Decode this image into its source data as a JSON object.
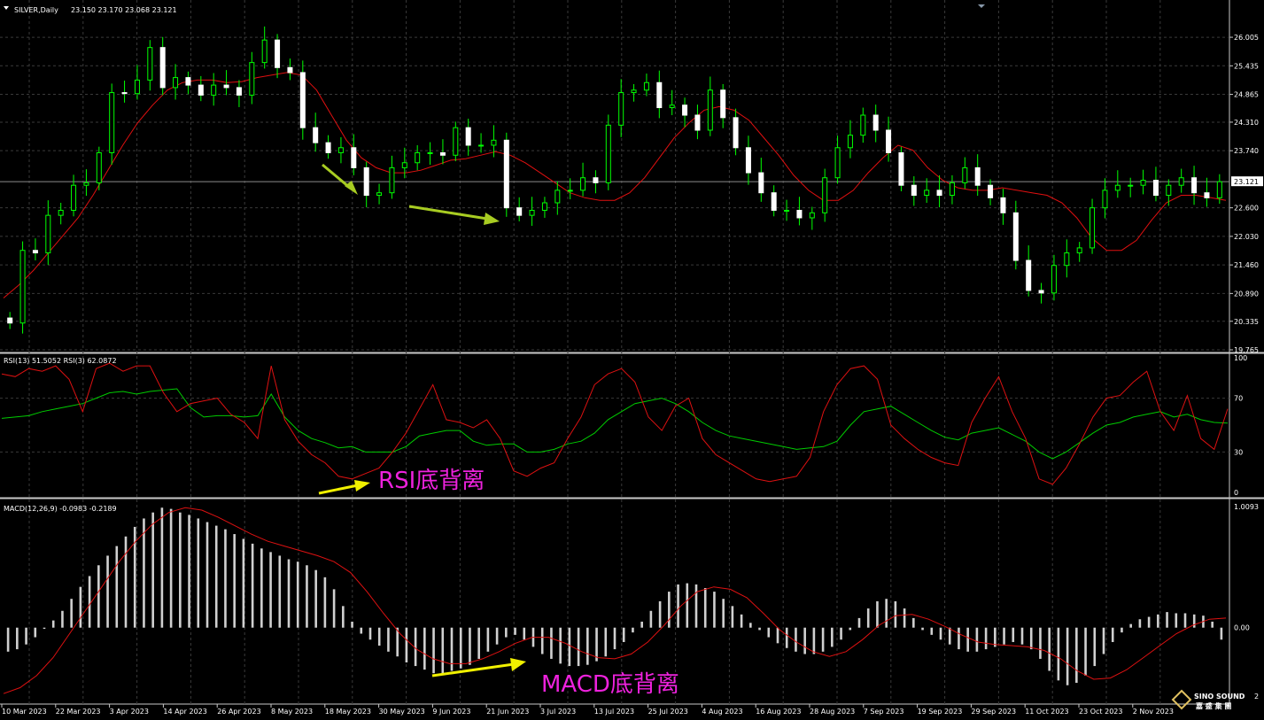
{
  "chart_data": [
    {
      "type": "candlestick",
      "title": "SILVER,Daily",
      "ohlc_header": "23.150 23.170 23.068 23.121",
      "ylim": [
        19.765,
        26.13
      ],
      "y_ticks": [
        "26.005",
        "25.435",
        "24.865",
        "24.310",
        "23.740",
        "23.121",
        "22.600",
        "22.030",
        "21.460",
        "20.890",
        "20.335",
        "19.765"
      ],
      "current_price": "23.121",
      "grid": true,
      "series": [
        {
          "name": "close",
          "color": "#00ff00",
          "values": [
            20.3,
            21.75,
            21.7,
            22.45,
            22.55,
            23.05,
            23.1,
            23.7,
            24.9,
            24.88,
            25.15,
            25.8,
            25.0,
            25.2,
            25.05,
            24.85,
            25.05,
            25.0,
            24.85,
            25.5,
            25.95,
            25.4,
            25.3,
            24.2,
            23.9,
            23.7,
            23.8,
            23.4,
            22.85,
            22.9,
            23.4,
            23.5,
            23.7,
            23.7,
            23.65,
            24.2,
            23.85,
            23.85,
            23.95,
            22.6,
            22.45,
            22.55,
            22.7,
            22.95,
            22.95,
            23.2,
            23.1,
            24.25,
            24.9,
            24.95,
            25.1,
            24.6,
            24.65,
            24.45,
            24.15,
            24.95,
            24.4,
            23.8,
            23.3,
            22.9,
            22.55,
            22.55,
            22.4,
            22.5,
            23.2,
            23.8,
            24.05,
            24.45,
            24.15,
            23.7,
            23.05,
            22.85,
            22.95,
            22.85,
            23.1,
            23.4,
            23.05,
            22.8,
            22.5,
            21.55,
            20.95,
            20.9,
            21.45,
            21.7,
            21.8,
            22.6,
            22.95,
            23.05,
            23.05,
            23.15,
            22.85,
            23.05,
            23.2,
            22.9,
            22.8,
            23.121
          ]
        },
        {
          "name": "ma",
          "color": "#e01010",
          "values": [
            20.8,
            21.05,
            21.35,
            21.7,
            22.05,
            22.4,
            22.85,
            23.35,
            23.85,
            24.3,
            24.65,
            24.95,
            25.1,
            25.15,
            25.15,
            25.1,
            25.12,
            25.2,
            25.25,
            25.3,
            25.25,
            24.95,
            24.45,
            23.95,
            23.6,
            23.4,
            23.3,
            23.3,
            23.35,
            23.45,
            23.55,
            23.58,
            23.65,
            23.72,
            23.65,
            23.5,
            23.3,
            23.1,
            22.9,
            22.8,
            22.75,
            22.75,
            22.9,
            23.2,
            23.6,
            24.0,
            24.3,
            24.55,
            24.62,
            24.55,
            24.35,
            24.0,
            23.65,
            23.25,
            22.95,
            22.75,
            22.75,
            22.95,
            23.3,
            23.6,
            23.85,
            23.75,
            23.4,
            23.15,
            23.0,
            22.95,
            22.95,
            23.0,
            22.95,
            22.9,
            22.85,
            22.7,
            22.4,
            22.0,
            21.75,
            21.75,
            21.95,
            22.35,
            22.7,
            22.85,
            22.85,
            22.8,
            22.75
          ]
        }
      ]
    },
    {
      "type": "line",
      "title": "RSI(13) 51.5052  RSI(3) 62.0872",
      "ylim": [
        0,
        100
      ],
      "y_ticks": [
        "100",
        "70",
        "30",
        "0"
      ],
      "series": [
        {
          "name": "RSI(13)",
          "color": "#00cc00",
          "values": [
            55,
            56,
            57,
            60,
            62,
            64,
            66,
            70,
            74,
            75,
            73,
            75,
            76,
            77,
            63,
            56,
            57,
            57,
            56,
            57,
            73,
            56,
            46,
            40,
            37,
            33,
            34,
            30,
            30,
            30,
            34,
            42,
            44,
            46,
            46,
            38,
            35,
            36,
            36,
            30,
            30,
            32,
            36,
            38,
            44,
            54,
            60,
            66,
            68,
            70,
            66,
            60,
            52,
            46,
            42,
            40,
            38,
            36,
            34,
            32,
            33,
            34,
            38,
            50,
            60,
            62,
            64,
            58,
            52,
            46,
            41,
            39,
            44,
            46,
            48,
            43,
            38,
            30,
            25,
            30,
            37,
            44,
            50,
            52,
            56,
            58,
            60,
            56,
            58,
            54,
            52,
            51.5
          ]
        },
        {
          "name": "RSI(3)",
          "color": "#dd1111",
          "values": [
            88,
            86,
            92,
            90,
            94,
            84,
            60,
            92,
            96,
            90,
            94,
            94,
            74,
            60,
            66,
            68,
            70,
            58,
            52,
            40,
            94,
            54,
            38,
            28,
            22,
            12,
            10,
            14,
            18,
            30,
            44,
            62,
            80,
            54,
            52,
            48,
            54,
            40,
            16,
            12,
            18,
            22,
            40,
            56,
            80,
            88,
            92,
            82,
            56,
            46,
            64,
            70,
            40,
            28,
            22,
            16,
            10,
            8,
            10,
            12,
            26,
            60,
            80,
            92,
            94,
            84,
            50,
            40,
            32,
            26,
            22,
            20,
            52,
            70,
            86,
            60,
            40,
            10,
            6,
            18,
            36,
            56,
            70,
            72,
            82,
            90,
            60,
            46,
            72,
            40,
            32,
            62.09
          ]
        }
      ]
    },
    {
      "type": "bar",
      "title": "MACD(12,26,9) -0.0983 -0.2189",
      "ylim": [
        -0.6,
        1.0093
      ],
      "y_ticks": [
        "1.0093",
        "0.00"
      ],
      "series": [
        {
          "name": "MACD",
          "color": "#d0d0d0",
          "values": [
            -0.2,
            -0.18,
            -0.14,
            -0.08,
            -0.01,
            0.06,
            0.14,
            0.24,
            0.34,
            0.43,
            0.52,
            0.6,
            0.68,
            0.76,
            0.84,
            0.91,
            0.96,
            1.0,
            0.99,
            0.96,
            0.94,
            0.91,
            0.88,
            0.85,
            0.82,
            0.78,
            0.74,
            0.7,
            0.66,
            0.63,
            0.6,
            0.57,
            0.55,
            0.52,
            0.48,
            0.42,
            0.32,
            0.18,
            0.05,
            -0.05,
            -0.1,
            -0.15,
            -0.2,
            -0.24,
            -0.29,
            -0.32,
            -0.35,
            -0.38,
            -0.38,
            -0.36,
            -0.34,
            -0.31,
            -0.26,
            -0.2,
            -0.14,
            -0.08,
            -0.06,
            -0.1,
            -0.16,
            -0.22,
            -0.26,
            -0.3,
            -0.32,
            -0.32,
            -0.31,
            -0.28,
            -0.24,
            -0.18,
            -0.12,
            -0.04,
            0.05,
            0.14,
            0.22,
            0.3,
            0.36,
            0.37,
            0.36,
            0.33,
            0.3,
            0.24,
            0.18,
            0.11,
            0.04,
            -0.02,
            -0.08,
            -0.13,
            -0.17,
            -0.2,
            -0.22,
            -0.22,
            -0.2,
            -0.16,
            -0.1,
            -0.02,
            0.08,
            0.16,
            0.22,
            0.24,
            0.22,
            0.16,
            0.08,
            -0.02,
            -0.06,
            -0.1,
            -0.14,
            -0.18,
            -0.2,
            -0.2,
            -0.18,
            -0.16,
            -0.14,
            -0.12,
            -0.14,
            -0.18,
            -0.26,
            -0.36,
            -0.44,
            -0.48,
            -0.46,
            -0.4,
            -0.32,
            -0.22,
            -0.12,
            -0.04,
            0.03,
            0.07,
            0.09,
            0.11,
            0.13,
            0.12,
            0.12,
            0.11,
            0.1,
            0.05,
            -0.1
          ]
        },
        {
          "name": "Signal",
          "color": "#dd1111",
          "values": [
            -0.55,
            -0.5,
            -0.4,
            -0.25,
            -0.05,
            0.15,
            0.35,
            0.55,
            0.72,
            0.86,
            0.96,
            1.0,
            0.98,
            0.92,
            0.85,
            0.78,
            0.72,
            0.68,
            0.64,
            0.6,
            0.55,
            0.46,
            0.3,
            0.12,
            -0.05,
            -0.18,
            -0.26,
            -0.3,
            -0.3,
            -0.26,
            -0.2,
            -0.13,
            -0.08,
            -0.08,
            -0.13,
            -0.2,
            -0.25,
            -0.26,
            -0.22,
            -0.12,
            0.02,
            0.18,
            0.3,
            0.34,
            0.32,
            0.25,
            0.12,
            -0.02,
            -0.12,
            -0.2,
            -0.24,
            -0.2,
            -0.1,
            0.02,
            0.1,
            0.11,
            0.07,
            0.01,
            -0.06,
            -0.12,
            -0.14,
            -0.15,
            -0.16,
            -0.19,
            -0.26,
            -0.36,
            -0.43,
            -0.42,
            -0.35,
            -0.25,
            -0.15,
            -0.05,
            0.02,
            0.07,
            0.08
          ]
        }
      ],
      "annotations": [
        "RSI底背离",
        "MACD底背离"
      ]
    }
  ],
  "x_ticks": [
    "10 Mar 2023",
    "22 Mar 2023",
    "3 Apr 2023",
    "14 Apr 2023",
    "26 Apr 2023",
    "8 May 2023",
    "18 May 2023",
    "30 May 2023",
    "9 Jun 2023",
    "21 Jun 2023",
    "3 Jul 2023",
    "13 Jul 2023",
    "25 Jul 2023",
    "4 Aug 2023",
    "16 Aug 2023",
    "28 Aug 2023",
    "7 Sep 2023",
    "19 Sep 2023",
    "29 Sep 2023",
    "11 Oct 2023",
    "23 Oct 2023",
    "2 Nov 2023"
  ],
  "annotations": {
    "rsi_label": "RSI底背离",
    "macd_label": "MACD底背离"
  },
  "logo": {
    "line1": "SINO SOUND",
    "line2": "嘉 盛 集 團",
    "suffix": "2"
  },
  "colors": {
    "background": "#000000",
    "grid": "#3a3a3a",
    "bull": "#00ff00",
    "bear": "#ffffff",
    "ma": "#e01010",
    "arrow_green": "#a8cc22",
    "arrow_yellow": "#f0f000",
    "annotation": "#ee22dd"
  }
}
